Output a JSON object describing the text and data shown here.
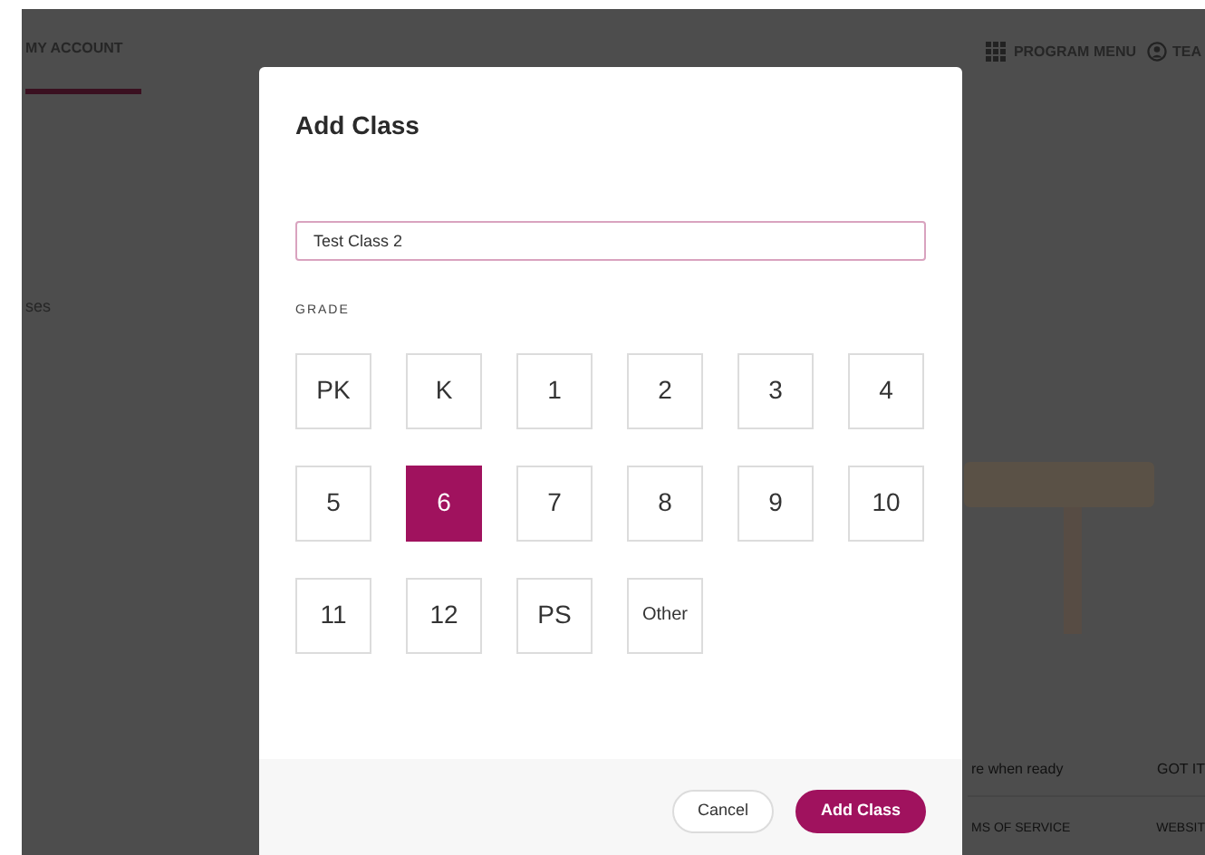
{
  "background": {
    "nav_tab": {
      "label": "MY ACCOUNT",
      "selected": true
    },
    "program_menu": "PROGRAM MENU",
    "user_menu": "TEA",
    "side_text": "ses",
    "banner_text": "re when ready",
    "banner_action": "GOT IT",
    "footer_links": [
      "MS OF SERVICE",
      "WEBSIT"
    ]
  },
  "dialog": {
    "title": "Add Class",
    "name_field": {
      "value": "Test Class 2"
    },
    "grade_label": "GRADE",
    "grades": [
      {
        "label": "PK",
        "selected": false
      },
      {
        "label": "K",
        "selected": false
      },
      {
        "label": "1",
        "selected": false
      },
      {
        "label": "2",
        "selected": false
      },
      {
        "label": "3",
        "selected": false
      },
      {
        "label": "4",
        "selected": false
      },
      {
        "label": "5",
        "selected": false
      },
      {
        "label": "6",
        "selected": true
      },
      {
        "label": "7",
        "selected": false
      },
      {
        "label": "8",
        "selected": false
      },
      {
        "label": "9",
        "selected": false
      },
      {
        "label": "10",
        "selected": false
      },
      {
        "label": "11",
        "selected": false
      },
      {
        "label": "12",
        "selected": false
      },
      {
        "label": "PS",
        "selected": false
      },
      {
        "label": "Other",
        "selected": false
      }
    ],
    "buttons": [
      {
        "label": "Cancel",
        "kind": "secondary"
      },
      {
        "label": "Add Class",
        "kind": "primary"
      }
    ]
  }
}
